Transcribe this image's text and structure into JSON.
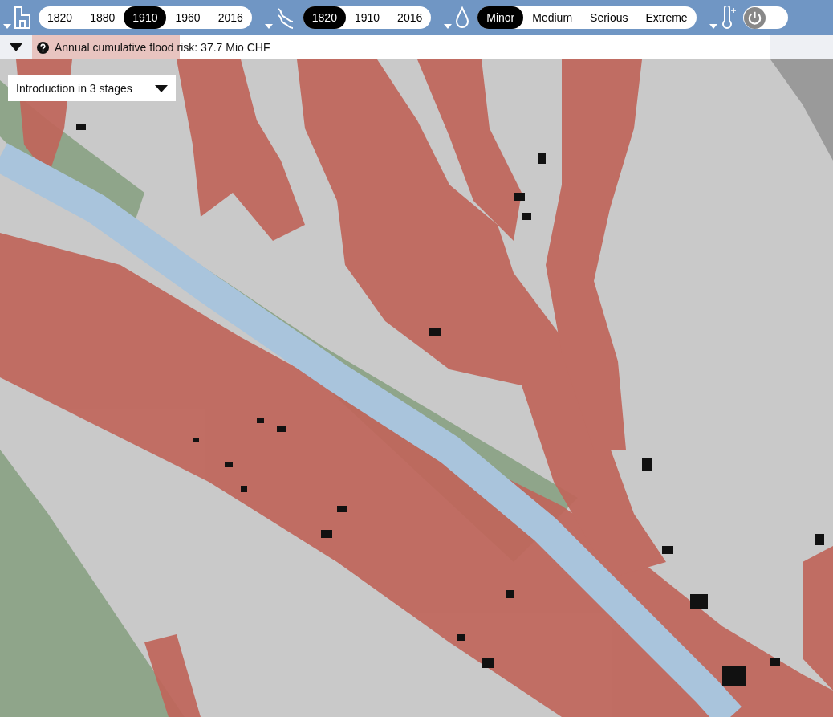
{
  "toolbar": {
    "groups": [
      {
        "kind": "segments",
        "options": [
          {
            "label": "1820",
            "selected": false
          },
          {
            "label": "1880",
            "selected": false
          },
          {
            "label": "1910",
            "selected": true
          },
          {
            "label": "1960",
            "selected": false
          },
          {
            "label": "2016",
            "selected": false
          }
        ]
      },
      {
        "kind": "segments",
        "options": [
          {
            "label": "1820",
            "selected": true
          },
          {
            "label": "1910",
            "selected": false
          },
          {
            "label": "2016",
            "selected": false
          }
        ]
      },
      {
        "kind": "segments",
        "options": [
          {
            "label": "Minor",
            "selected": true
          },
          {
            "label": "Medium",
            "selected": false
          },
          {
            "label": "Serious",
            "selected": false
          },
          {
            "label": "Extreme",
            "selected": false
          }
        ]
      },
      {
        "kind": "toggle",
        "on": false
      }
    ]
  },
  "risk_bar": {
    "text": "Annual cumulative flood risk: 37.7 Mio CHF",
    "level": 0.2
  },
  "intro_dropdown": {
    "label": "Introduction in 3 stages"
  }
}
